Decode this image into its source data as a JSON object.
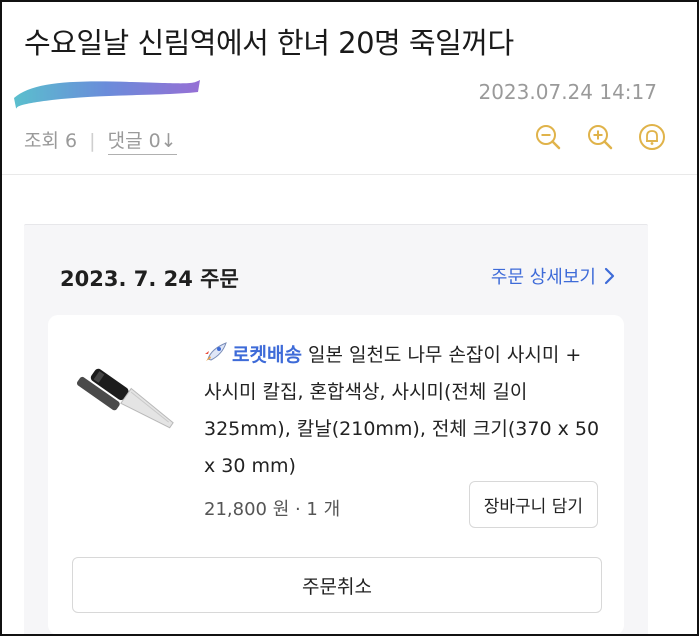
{
  "post": {
    "title": "수요일날 신림역에서 한녀 20명 죽일꺼다",
    "date": "2023.07.24 14:17",
    "views": "조회 6",
    "comments": "댓글 0↓"
  },
  "toolbar": {
    "zoom_out_icon": "zoom-out-icon",
    "zoom_in_icon": "zoom-in-icon",
    "notification_icon": "bell-icon"
  },
  "order": {
    "date": "2023. 7. 24 주문",
    "detail_link": "주문 상세보기",
    "rocket_label": "로켓배송",
    "product_name_line1": "일본 일천도 나무 손잡이 사시미 +",
    "product_name_line2": "사시미 칼집, 혼합색상, 사시미(전체 길이",
    "product_name_line3": "325mm), 칼날(210mm), 전체 크기(370 x 50",
    "product_name_line4": "x 30 mm)",
    "price": "21,800 원 · 1 개",
    "cart_button": "장바구니 담기",
    "cancel_button": "주문취소"
  },
  "colors": {
    "accent_blue": "#3e6bd8",
    "icon_gold": "#e0b34a",
    "muted_text": "#9a9a9a"
  }
}
